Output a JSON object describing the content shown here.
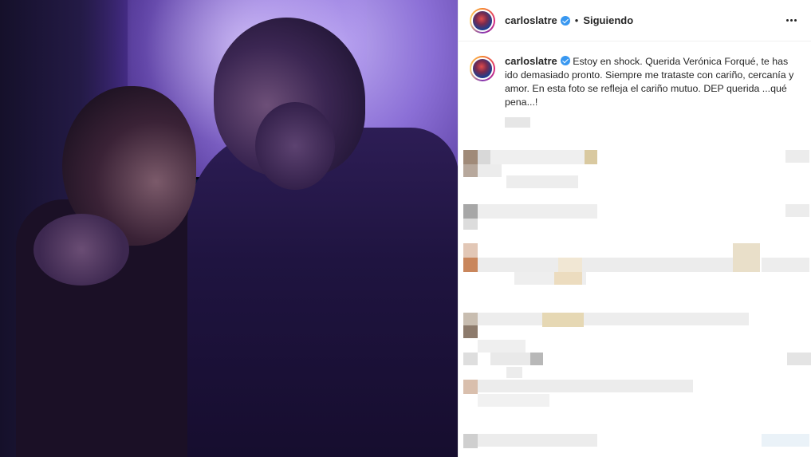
{
  "post": {
    "username": "carloslatre",
    "follow_status": "Siguiendo",
    "caption": "Estoy en shock. Querida Verónica Forqué, te has ido demasiado pronto. Siempre me trataste con cariño, cercanía y amor. En esta foto se refleja el cariño mutuo. DEP querida ...qué pena...!"
  },
  "icons": {
    "verified": "verified-badge-icon",
    "more": "more-options-icon"
  },
  "colors": {
    "verified_blue": "#3897f0",
    "text": "#262626",
    "divider": "#efefef"
  }
}
